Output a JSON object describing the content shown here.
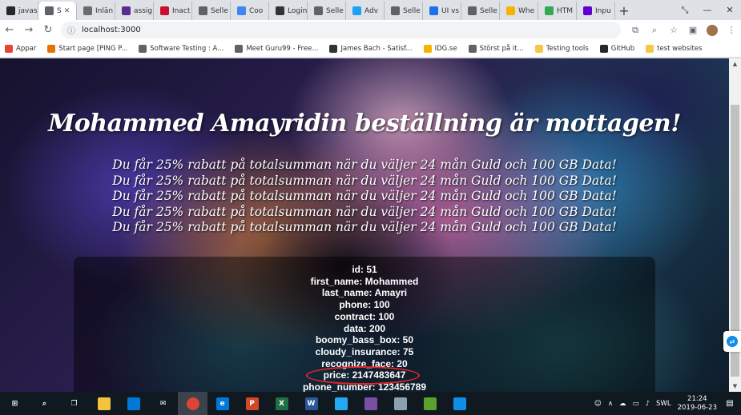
{
  "browser": {
    "tabs": [
      {
        "label": "javas",
        "color": "#24292e",
        "active": false
      },
      {
        "label": "S",
        "color": "#5f6368",
        "active": true
      },
      {
        "label": "Inlän",
        "color": "#6b6b6b",
        "active": false
      },
      {
        "label": "assig",
        "color": "#5c2d91",
        "active": false
      },
      {
        "label": "Inact",
        "color": "#c8102e",
        "active": false
      },
      {
        "label": "Selle",
        "color": "#5f6368",
        "active": false
      },
      {
        "label": "Coo",
        "color": "#4285f4",
        "active": false
      },
      {
        "label": "Login",
        "color": "#333333",
        "active": false
      },
      {
        "label": "Selle",
        "color": "#5f6368",
        "active": false
      },
      {
        "label": "Adv",
        "color": "#1da1f2",
        "active": false
      },
      {
        "label": "Selle",
        "color": "#5f6368",
        "active": false
      },
      {
        "label": "UI vs",
        "color": "#1a73e8",
        "active": false
      },
      {
        "label": "Selle",
        "color": "#5f6368",
        "active": false
      },
      {
        "label": "Whe",
        "color": "#f4b400",
        "active": false
      },
      {
        "label": "HTM",
        "color": "#34a853",
        "active": false
      },
      {
        "label": "Inpu",
        "color": "#6001d2",
        "active": false
      }
    ],
    "new_tab": "+",
    "window_controls": [
      "⤡",
      "—",
      "✕"
    ],
    "url": "localhost:3000",
    "bookmarks": [
      {
        "label": "Appar",
        "color": "#ea4335"
      },
      {
        "label": "Start page [PING P...",
        "color": "#e37400"
      },
      {
        "label": "Software Testing : A...",
        "color": "#5f6368"
      },
      {
        "label": "Meet Guru99 - Free...",
        "color": "#5f6368"
      },
      {
        "label": "James Bach - Satisf...",
        "color": "#333333"
      },
      {
        "label": "IDG.se",
        "color": "#f4b400"
      },
      {
        "label": "Störst på it...",
        "color": "#5f6368"
      },
      {
        "label": "Testing tools",
        "color": "#f6c744"
      },
      {
        "label": "GitHub",
        "color": "#24292e"
      },
      {
        "label": "test websites",
        "color": "#f6c744"
      }
    ]
  },
  "page": {
    "heading": "Mohammed Amayridin beställning är mottagen!",
    "promo_lines": [
      "Du får 25% rabatt på totalsumman när du väljer 24 mån Guld och 100 GB Data!",
      "Du får 25% rabatt på totalsumman när du väljer 24 mån Guld och 100 GB Data!",
      "Du får 25% rabatt på totalsumman när du väljer 24 mån Guld och 100 GB Data!",
      "Du får 25% rabatt på totalsumman när du väljer 24 mån Guld och 100 GB Data!",
      "Du får 25% rabatt på totalsumman när du väljer 24 mån Guld och 100 GB Data!"
    ],
    "fields": [
      "id: 51",
      "first_name: Mohammed",
      "last_name: Amayri",
      "phone: 100",
      "contract: 100",
      "data: 200",
      "boomy_bass_box: 50",
      "cloudy_insurance: 75",
      "recognize_face: 20",
      "price: 2147483647",
      "phone_number: 123456789"
    ],
    "highlighted_field_index": 9,
    "highlight_color": "#e0262a"
  },
  "taskbar": {
    "apps": [
      {
        "name": "windows",
        "glyph": "⊞",
        "color": "transparent"
      },
      {
        "name": "search",
        "glyph": "⌕",
        "color": "transparent"
      },
      {
        "name": "task-view",
        "glyph": "❐",
        "color": "transparent"
      },
      {
        "name": "file-explorer",
        "glyph": "",
        "color": "#f3c33d"
      },
      {
        "name": "store",
        "glyph": "",
        "color": "#0078d7"
      },
      {
        "name": "mail",
        "glyph": "✉",
        "color": "transparent"
      },
      {
        "name": "chrome",
        "glyph": "",
        "color": "#db4437"
      },
      {
        "name": "edge",
        "glyph": "e",
        "color": "#0078d7"
      },
      {
        "name": "powerpoint",
        "glyph": "P",
        "color": "#d24726"
      },
      {
        "name": "excel",
        "glyph": "X",
        "color": "#1e7145"
      },
      {
        "name": "word",
        "glyph": "W",
        "color": "#2b579a"
      },
      {
        "name": "vscode",
        "glyph": "",
        "color": "#23a9f2"
      },
      {
        "name": "app-swirl",
        "glyph": "",
        "color": "#7b4ea6"
      },
      {
        "name": "app-feather",
        "glyph": "",
        "color": "#8ca0b3"
      },
      {
        "name": "app-bug",
        "glyph": "",
        "color": "#5aa02c"
      },
      {
        "name": "teamviewer",
        "glyph": "",
        "color": "#0e8ee9"
      }
    ],
    "tray_lang": "SWL",
    "time": "21:24",
    "date": "2019-06-23"
  }
}
